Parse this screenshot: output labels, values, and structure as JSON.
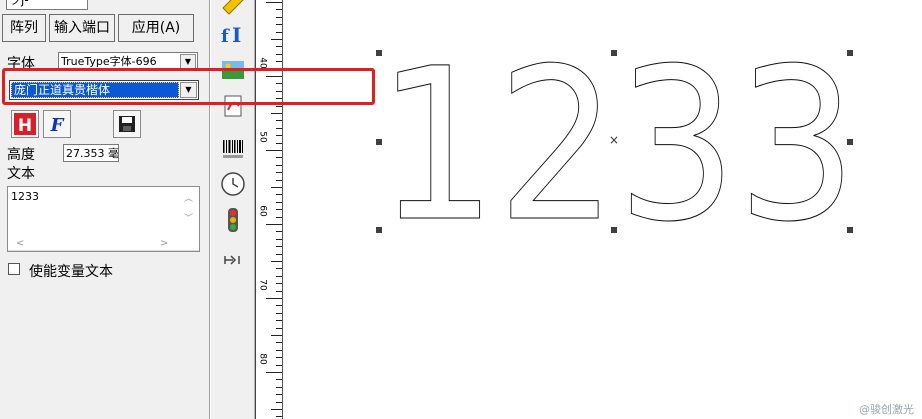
{
  "props_panel": {
    "top_field_value": "ヲj-",
    "tabs": [
      "阵列",
      "输入端口",
      "应用(A)"
    ],
    "font_label": "字体",
    "font_type_value": "TrueType字体-696",
    "font_name_value": "庞门正道真贵楷体",
    "height_label": "高度",
    "height_value": "27.353",
    "height_unit": "毫",
    "text_label": "文本",
    "text_value": "1233",
    "variable_text_label": "使能变量文本"
  },
  "ruler": {
    "labels": [
      "40",
      "50",
      "60",
      "70",
      "80"
    ]
  },
  "canvas": {
    "text": "1233",
    "watermark": "@骏创激光"
  },
  "colors": {
    "highlight": "#0a58d6",
    "annotation_frame": "#e02020"
  }
}
